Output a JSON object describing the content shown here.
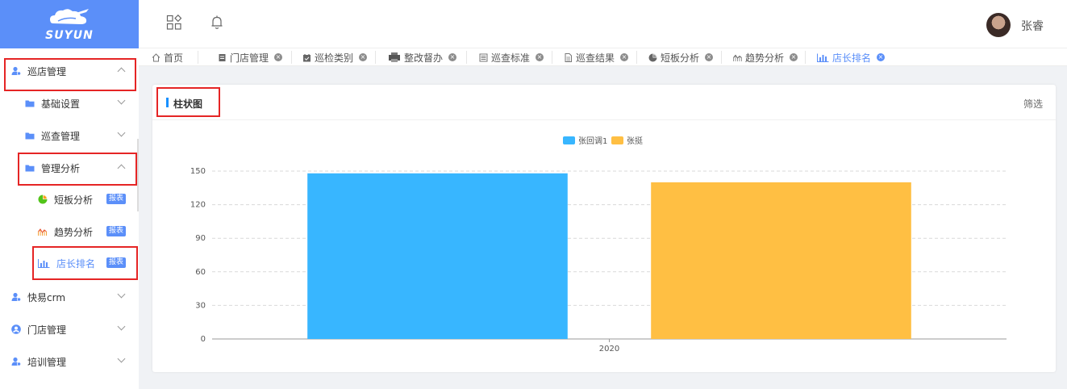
{
  "brand": {
    "logo_text": "SUYUN"
  },
  "sidebar": {
    "items": [
      {
        "label": "巡店管理",
        "icon": "user-group-icon"
      },
      {
        "label": "基础设置",
        "icon": "folder-icon"
      },
      {
        "label": "巡查管理",
        "icon": "folder-icon"
      },
      {
        "label": "管理分析",
        "icon": "folder-icon"
      },
      {
        "label": "短板分析",
        "icon": "pie-chart-icon",
        "badge": "报表"
      },
      {
        "label": "趋势分析",
        "icon": "trend-icon",
        "badge": "报表"
      },
      {
        "label": "店长排名",
        "icon": "bar-chart-icon",
        "badge": "报表"
      },
      {
        "label": "快易crm",
        "icon": "user-group-icon"
      },
      {
        "label": "门店管理",
        "icon": "user-circle-icon"
      },
      {
        "label": "培训管理",
        "icon": "user-group-icon"
      }
    ]
  },
  "header": {
    "username": "张睿",
    "icons": [
      "apps-icon",
      "bell-icon"
    ]
  },
  "tabs": [
    {
      "label": "首页",
      "icon": "home-icon"
    },
    {
      "label": "门店管理",
      "icon": "store-icon"
    },
    {
      "label": "巡检类别",
      "icon": "calendar-check-icon"
    },
    {
      "label": "整改督办",
      "icon": "printer-icon"
    },
    {
      "label": "巡查标准",
      "icon": "list-icon"
    },
    {
      "label": "巡查结果",
      "icon": "document-icon"
    },
    {
      "label": "短板分析",
      "icon": "pie-chart-icon"
    },
    {
      "label": "趋势分析",
      "icon": "trend-icon"
    },
    {
      "label": "店长排名",
      "icon": "bar-chart-icon"
    }
  ],
  "card": {
    "title": "柱状图",
    "filter_label": "筛选"
  },
  "colors": {
    "accent": "#5b8ff9",
    "highlight_border": "#e52525",
    "series_1": "#38b6ff",
    "series_2": "#ffbf43"
  },
  "chart_data": {
    "type": "bar",
    "title": "",
    "categories": [
      "2020"
    ],
    "series": [
      {
        "name": "张回调1",
        "values": [
          148
        ]
      },
      {
        "name": "张挺",
        "values": [
          140
        ]
      }
    ],
    "ylim": [
      0,
      150
    ],
    "yticks": [
      0,
      30,
      60,
      90,
      120,
      150
    ],
    "grid": true,
    "legend": "top-center"
  }
}
